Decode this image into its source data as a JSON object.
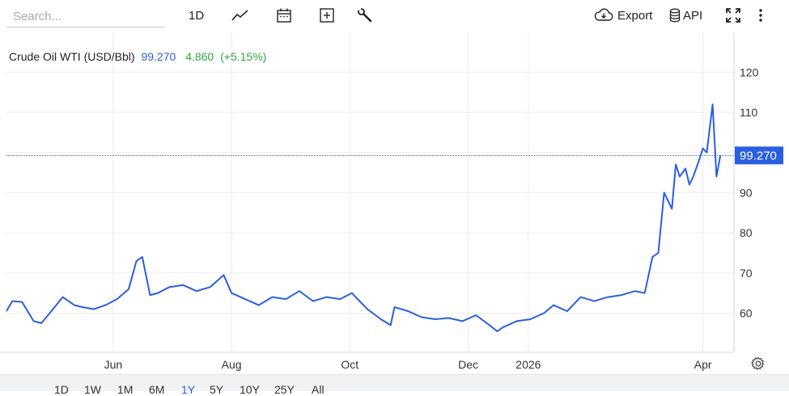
{
  "toolbar": {
    "search_placeholder": "Search...",
    "interval_label": "1D",
    "export_label": "Export",
    "api_label": "API",
    "icons": [
      "line-chart-icon",
      "calendar-icon",
      "plus-box-icon",
      "wrench-icon",
      "cloud-download-icon",
      "database-icon",
      "fullscreen-icon",
      "more-vert-icon"
    ]
  },
  "legend": {
    "name": "Crude Oil WTI (USD/Bbl)",
    "price": "99.270",
    "change": "4.860",
    "change_pct": "(+5.15%)"
  },
  "colors": {
    "line": "#2a5fe0",
    "up": "#2eaa3c",
    "price_tag_bg": "#2a5fe0",
    "grid": "#ececec",
    "axis": "#d6d6d6"
  },
  "range_buttons": [
    "1D",
    "1W",
    "1M",
    "6M",
    "1Y",
    "5Y",
    "10Y",
    "25Y",
    "All"
  ],
  "active_range": "1Y",
  "chart_data": {
    "type": "line",
    "series": [
      {
        "name": "Crude Oil WTI (USD/Bbl)",
        "x": [
          "2025-04-07",
          "2025-04-10",
          "2025-04-15",
          "2025-04-21",
          "2025-04-25",
          "2025-05-01",
          "2025-05-06",
          "2025-05-12",
          "2025-05-16",
          "2025-05-22",
          "2025-05-28",
          "2025-06-03",
          "2025-06-09",
          "2025-06-13",
          "2025-06-16",
          "2025-06-20",
          "2025-06-24",
          "2025-06-30",
          "2025-07-07",
          "2025-07-14",
          "2025-07-21",
          "2025-07-28",
          "2025-08-01",
          "2025-08-08",
          "2025-08-15",
          "2025-08-22",
          "2025-08-29",
          "2025-09-05",
          "2025-09-12",
          "2025-09-19",
          "2025-09-26",
          "2025-10-02",
          "2025-10-10",
          "2025-10-17",
          "2025-10-22",
          "2025-10-24",
          "2025-10-31",
          "2025-11-07",
          "2025-11-14",
          "2025-11-21",
          "2025-11-28",
          "2025-12-05",
          "2025-12-12",
          "2025-12-16",
          "2025-12-19",
          "2025-12-26",
          "2026-01-02",
          "2026-01-09",
          "2026-01-14",
          "2026-01-21",
          "2026-01-28",
          "2026-02-04",
          "2026-02-11",
          "2026-02-18",
          "2026-02-25",
          "2026-03-02",
          "2026-03-06",
          "2026-03-09",
          "2026-03-12",
          "2026-03-16",
          "2026-03-18",
          "2026-03-20",
          "2026-03-23",
          "2026-03-25",
          "2026-03-27",
          "2026-03-30",
          "2026-04-01",
          "2026-04-03",
          "2026-04-06",
          "2026-04-08",
          "2026-04-10"
        ],
        "values": [
          60.5,
          63.0,
          62.8,
          58.0,
          57.5,
          61.0,
          64.0,
          62.0,
          61.5,
          61.0,
          62.0,
          63.5,
          66.0,
          73.0,
          74.0,
          64.5,
          65.0,
          66.5,
          67.0,
          65.5,
          66.5,
          69.5,
          65.0,
          63.5,
          62.0,
          64.0,
          63.5,
          65.5,
          63.0,
          64.0,
          63.5,
          65.0,
          61.0,
          58.5,
          57.0,
          61.5,
          60.5,
          59.0,
          58.5,
          58.8,
          58.0,
          59.5,
          57.0,
          55.5,
          56.5,
          58.0,
          58.5,
          60.0,
          62.0,
          60.5,
          64.0,
          63.0,
          64.0,
          64.5,
          65.5,
          65.0,
          74.0,
          75.0,
          90.0,
          86.0,
          97.0,
          94.0,
          96.0,
          92.0,
          94.0,
          98.0,
          101.0,
          100.0,
          112.0,
          94.0,
          99.27
        ]
      }
    ],
    "x_ticks": [
      "Jun",
      "Aug",
      "Oct",
      "Dec",
      "2026",
      "Apr"
    ],
    "x_tick_dates": [
      "2025-06-01",
      "2025-08-01",
      "2025-10-01",
      "2025-12-01",
      "2026-01-01",
      "2026-04-01"
    ],
    "y_ticks": [
      60,
      70,
      80,
      90,
      100,
      110,
      120
    ],
    "y_tick_labels": [
      "60",
      "70",
      "80",
      "90",
      "",
      "110",
      "120"
    ],
    "ylim": [
      50,
      130
    ],
    "xlim": [
      "2025-04-07",
      "2026-04-17"
    ],
    "last_value_label": "99.270",
    "grid": true
  }
}
